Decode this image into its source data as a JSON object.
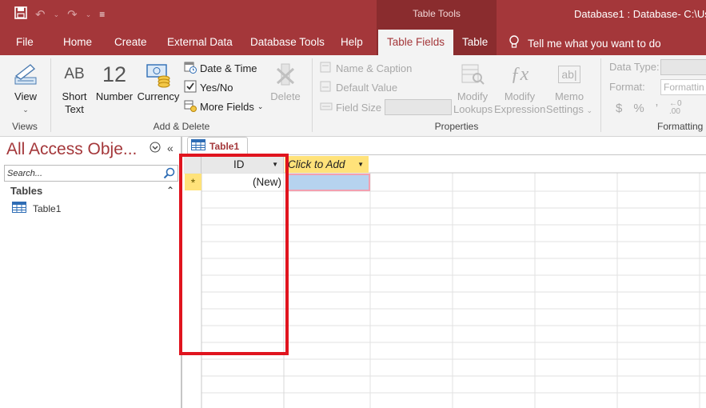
{
  "titlebar": {
    "context_label": "Table Tools",
    "document_title": "Database1 : Database- C:\\Use"
  },
  "tabs": {
    "file": "File",
    "home": "Home",
    "create": "Create",
    "external_data": "External Data",
    "database_tools": "Database Tools",
    "help": "Help",
    "table_fields": "Table Fields",
    "table": "Table",
    "tell_me": "Tell me what you want to do"
  },
  "ribbon": {
    "views": {
      "view_label": "View",
      "group_label": "Views"
    },
    "add_delete": {
      "short_text_icon": "AB",
      "short_text_line1": "Short",
      "short_text_line2": "Text",
      "number_icon": "12",
      "number_label": "Number",
      "currency_label": "Currency",
      "date_time": "Date & Time",
      "yes_no": "Yes/No",
      "more_fields": "More Fields",
      "delete": "Delete",
      "group_label": "Add & Delete"
    },
    "properties": {
      "name_caption": "Name & Caption",
      "default_value": "Default Value",
      "field_size": "Field Size",
      "modify_lookups_1": "Modify",
      "modify_lookups_2": "Lookups",
      "modify_expression_1": "Modify",
      "modify_expression_2": "Expression",
      "memo_settings_1": "Memo",
      "memo_settings_2": "Settings",
      "memo_icon": "ab|",
      "group_label": "Properties"
    },
    "formatting": {
      "data_type": "Data Type:",
      "format": "Format:",
      "format_placeholder": "Formattin",
      "currency_symbol": "$",
      "percent_symbol": "%",
      "comma_symbol": "’",
      "group_label": "Formatting"
    }
  },
  "navpane": {
    "title": "All Access Obje...",
    "search_placeholder": "Search...",
    "section": "Tables",
    "items": [
      {
        "label": "Table1"
      }
    ]
  },
  "document": {
    "tab_label": "Table1",
    "columns": {
      "id": "ID",
      "add": "Click to Add"
    },
    "new_row_marker": "*",
    "new_row_value": "(New)"
  },
  "colors": {
    "accent": "#a4373a",
    "context_band": "#8a2c2e",
    "header_highlight": "#ffe27a",
    "selected_cell": "#b6d3ef",
    "annotation_box": "#e0141e"
  }
}
